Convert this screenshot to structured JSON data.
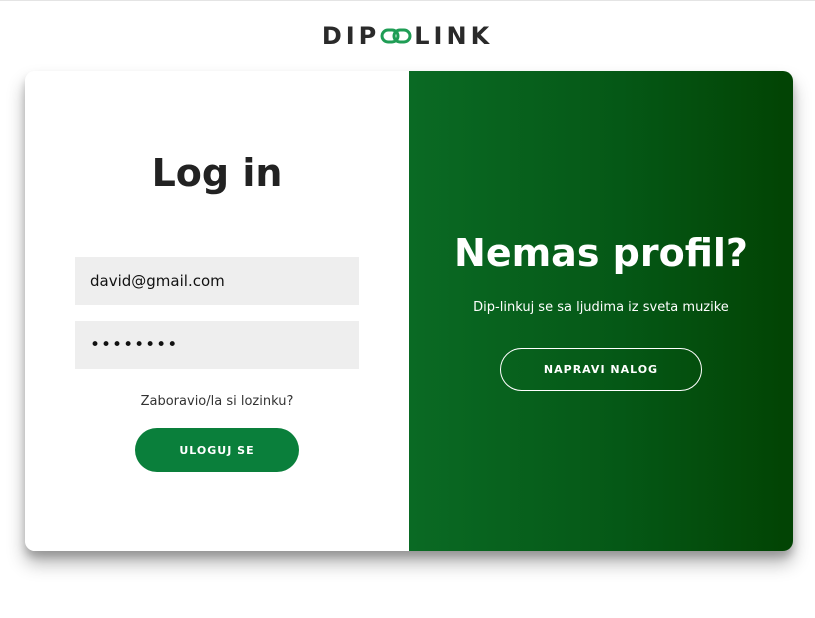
{
  "logo": {
    "text_left": "DIP",
    "text_right": "LINK",
    "icon": "chain-link-icon",
    "icon_color": "#1f9d55"
  },
  "login": {
    "title": "Log in",
    "email_value": "david@gmail.com",
    "password_value": "xxxxxxxx",
    "forgot_label": "Zaboravio/la si lozinku?",
    "submit_label": "ULOGUJ SE"
  },
  "signup": {
    "title": "Nemas profil?",
    "subtitle": "Dip-linkuj se sa ljudima iz sveta muzike",
    "button_label": "NAPRAVI NALOG"
  },
  "colors": {
    "primary_green": "#0a7f3b",
    "panel_green_start": "#0a6a24",
    "panel_green_end": "#024303",
    "input_bg": "#eeeeee"
  }
}
